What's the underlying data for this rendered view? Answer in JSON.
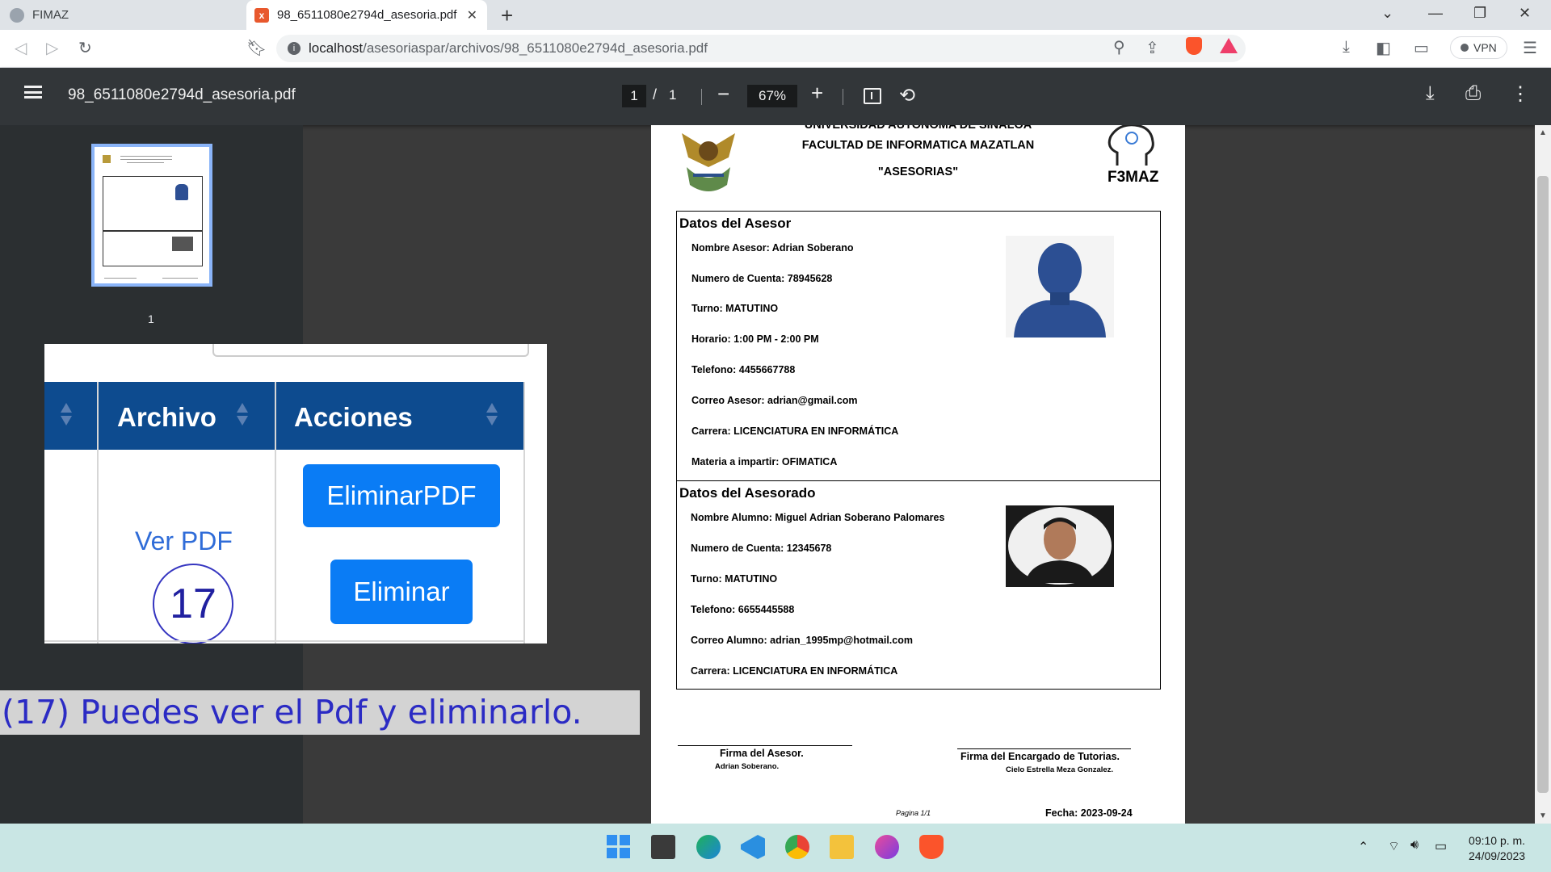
{
  "browser": {
    "tabs": [
      {
        "label": "FIMAZ"
      },
      {
        "label": "98_6511080e2794d_asesoria.pdf"
      }
    ],
    "url_host": "localhost",
    "url_path": "/asesoriaspar/archivos/98_6511080e2794d_asesoria.pdf",
    "vpn_label": "VPN"
  },
  "pdf_viewer": {
    "filename": "98_6511080e2794d_asesoria.pdf",
    "current_page": "1",
    "page_separator": "/",
    "total_pages": "1",
    "zoom": "67%",
    "thumbnail_label": "1"
  },
  "overlay": {
    "col_archivo": "Archivo",
    "col_acciones": "Acciones",
    "btn_eliminar_pdf": "EliminarPDF",
    "btn_eliminar": "Eliminar",
    "link_ver_pdf": "Ver PDF",
    "step_number": "17",
    "caption": "(17) Puedes ver el Pdf y eliminarlo."
  },
  "document": {
    "header_university": "UNIVERSIDAD AUTONOMA DE SINALOA",
    "header_faculty": "FACULTAD DE INFORMATICA MAZATLAN",
    "header_doc": "\"ASESORIAS\"",
    "logo_text": "F3MAZ",
    "asesor": {
      "title": "Datos del Asesor",
      "fields": [
        "Nombre Asesor: Adrian Soberano",
        "Numero de Cuenta:  78945628",
        "Turno:  MATUTINO",
        "Horario:  1:00 PM - 2:00 PM",
        "Telefono:  4455667788",
        "Correo Asesor:  adrian@gmail.com",
        "Carrera:  LICENCIATURA EN INFORMÁTICA",
        "Materia a impartir:   OFIMATICA"
      ]
    },
    "asesorado": {
      "title": "Datos del Asesorado",
      "fields": [
        "Nombre Alumno:  Miguel Adrian Soberano Palomares",
        "Numero de Cuenta:  12345678",
        "Turno:  MATUTINO",
        "Telefono: 6655445588",
        "Correo Alumno:   adrian_1995mp@hotmail.com",
        "Carrera:  LICENCIATURA EN INFORMÁTICA"
      ]
    },
    "sign_asesor_title": "Firma del Asesor.",
    "sign_asesor_name": "Adrian Soberano.",
    "sign_tutor_title": "Firma del Encargado de Tutorias.",
    "sign_tutor_name": "Cielo Estrella Meza Gonzalez.",
    "pagina": "Pagina 1/1",
    "fecha": "Fecha:   2023-09-24"
  },
  "taskbar": {
    "time": "09:10 p. m.",
    "date": "24/09/2023"
  },
  "colors": {
    "table_header": "#0d4b8f",
    "button_blue": "#0a7cf5",
    "pdf_toolbar": "#323639",
    "taskbar": "#c9e6e4"
  }
}
